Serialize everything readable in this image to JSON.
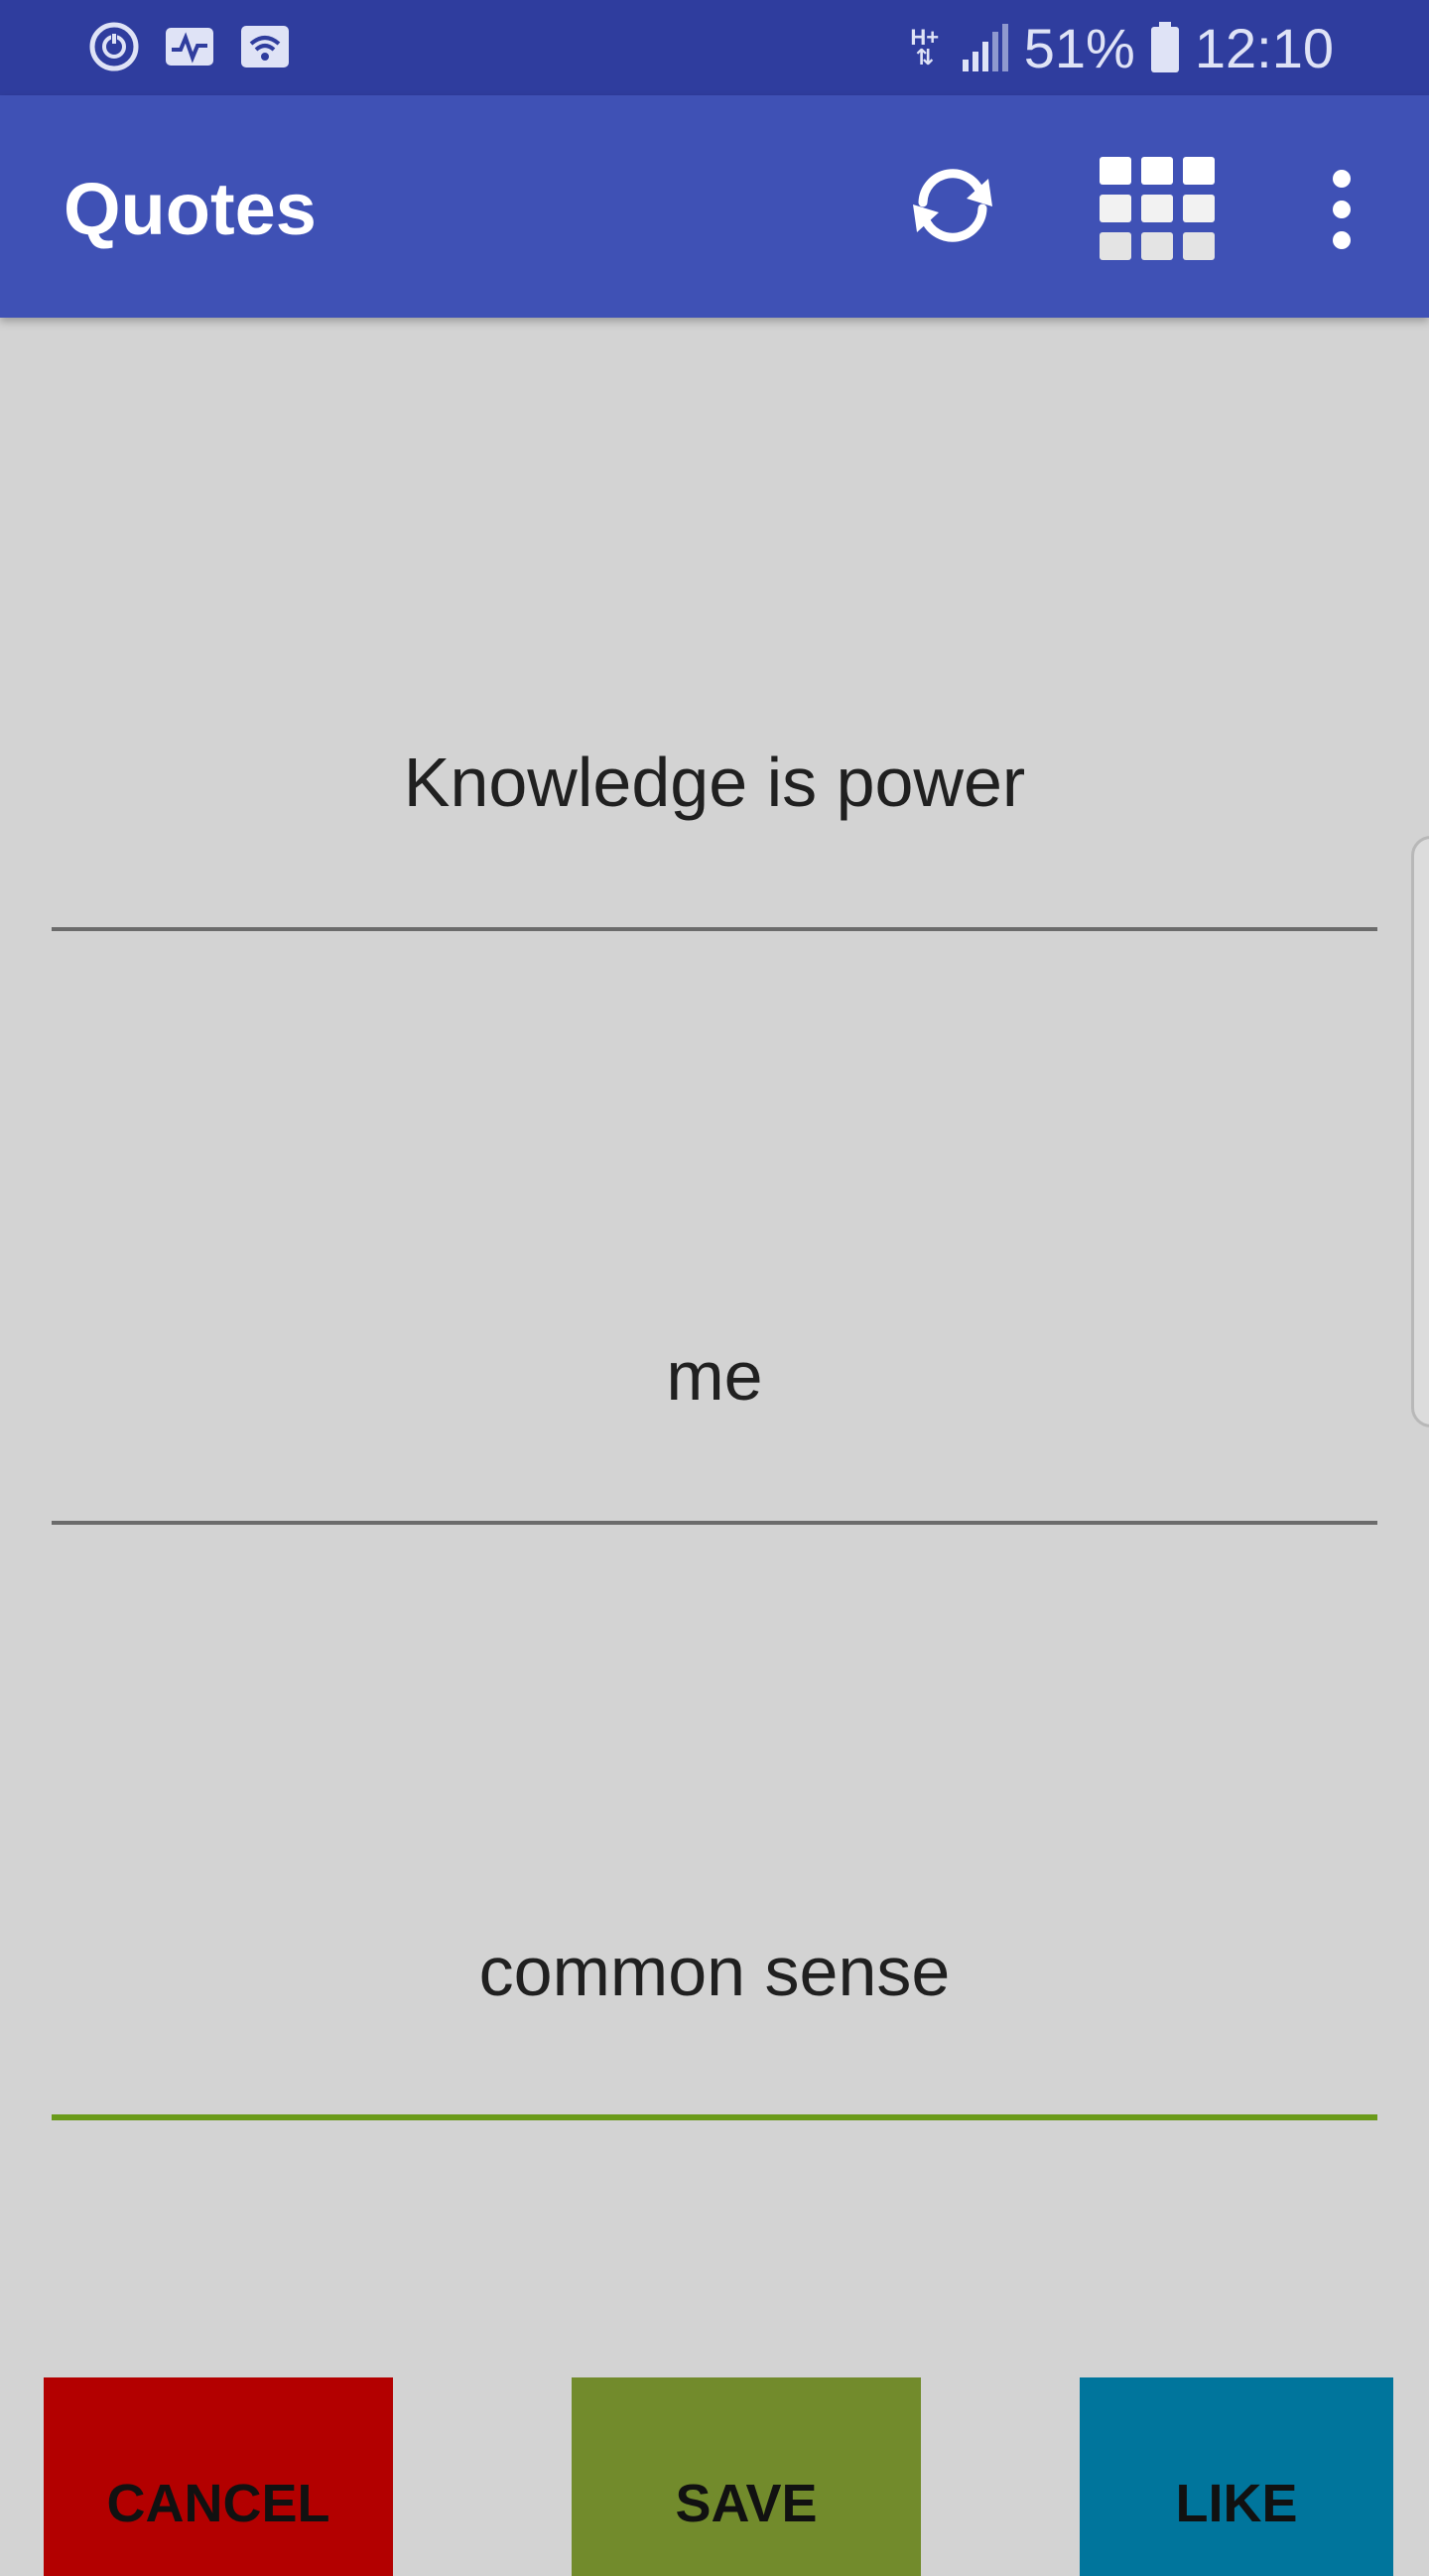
{
  "status_bar": {
    "network": "H+",
    "battery": "51%",
    "time": "12:10",
    "icons": [
      "sync-circle-icon",
      "activity-monitor-icon",
      "wifi-box-icon",
      "data-arrows-icon",
      "signal-icon",
      "battery-icon"
    ]
  },
  "app_bar": {
    "title": "Quotes",
    "actions": [
      "refresh-icon",
      "grid-icon",
      "more-vert-icon"
    ],
    "color": "#3f51b5"
  },
  "form": {
    "fields": [
      {
        "value": "Knowledge is power",
        "focused": false
      },
      {
        "value": "me",
        "focused": false
      },
      {
        "value": "common sense",
        "focused": true
      }
    ]
  },
  "buttons": {
    "cancel": {
      "label": "CANCEL",
      "color": "#b30000"
    },
    "save": {
      "label": "SAVE",
      "color": "#728b2c"
    },
    "like": {
      "label": "LIKE",
      "color": "#00759c"
    }
  }
}
